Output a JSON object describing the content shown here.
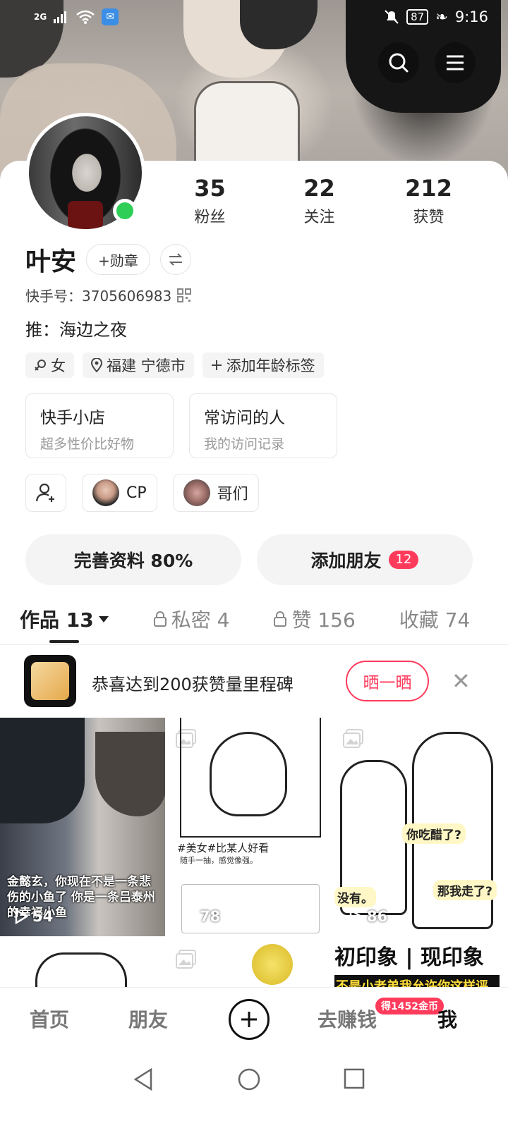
{
  "status_bar": {
    "signal": "2G",
    "battery": "87",
    "time": "9:16"
  },
  "header": {
    "search_icon": "search-icon",
    "menu_icon": "menu-icon"
  },
  "profile": {
    "name": "叶安",
    "online": true,
    "stats": [
      {
        "value": "35",
        "label": "粉丝"
      },
      {
        "value": "22",
        "label": "关注"
      },
      {
        "value": "212",
        "label": "获赞"
      }
    ],
    "medal_button": "+勋章",
    "kwai_id": "快手号：3705606983",
    "bio": "推：海边之夜",
    "tags": [
      {
        "icon": "gender-icon",
        "text": "女"
      },
      {
        "icon": "location-icon",
        "text": "福建 宁德市"
      },
      {
        "icon": "plus-icon",
        "text": "添加年龄标签"
      }
    ]
  },
  "features": [
    {
      "title": "快手小店",
      "subtitle": "超多性价比好物"
    },
    {
      "title": "常访问的人",
      "subtitle": "我的访问记录"
    }
  ],
  "chips": [
    {
      "label": "CP"
    },
    {
      "label": "哥们"
    }
  ],
  "actions": {
    "complete_profile": "完善资料 80%",
    "add_friends": "添加朋友",
    "add_friends_badge": "12"
  },
  "tabs": [
    {
      "label": "作品 13",
      "active": true,
      "locked": false
    },
    {
      "label": "私密 4",
      "active": false,
      "locked": true
    },
    {
      "label": "赞 156",
      "active": false,
      "locked": true
    },
    {
      "label": "收藏 74",
      "active": false,
      "locked": false
    }
  ],
  "milestone": {
    "text": "恭喜达到200获赞量里程碑",
    "button": "晒一晒"
  },
  "posts": [
    {
      "caption": "金懿玄，你现在不是一条悲伤的小鱼了 你是一条吕泰州的幸福小鱼",
      "plays": "54"
    },
    {
      "hashtag": "#美女#比某人好看",
      "hint": "随手一抽，感觉像强。",
      "plays": "78"
    },
    {
      "bubbles": [
        "你吃醋了?",
        "那我走了?",
        "没有。"
      ],
      "plays": "86"
    },
    {},
    {},
    {
      "top_text": "初印象 | 现印象",
      "sub_text": "不是小老弟我允许你这样评"
    }
  ],
  "bottom_nav": {
    "items": [
      "首页",
      "朋友",
      "去赚钱",
      "我"
    ],
    "coin_badge": "得1452金币"
  },
  "colors": {
    "accent": "#ff3b5c",
    "online": "#2fcf57"
  }
}
